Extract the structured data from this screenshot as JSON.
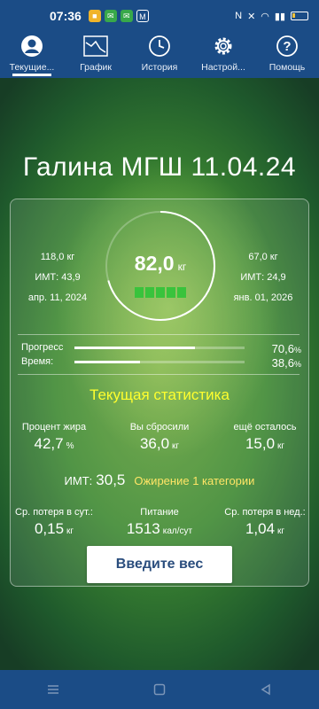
{
  "status_bar": {
    "time": "07:36"
  },
  "tabs": [
    {
      "label": "Текущие...",
      "icon": "person-icon",
      "active": true
    },
    {
      "label": "График",
      "icon": "chart-icon",
      "active": false
    },
    {
      "label": "История",
      "icon": "clock-icon",
      "active": false
    },
    {
      "label": "Настрой...",
      "icon": "gear-icon",
      "active": false
    },
    {
      "label": "Помощь",
      "icon": "help-icon",
      "active": false
    }
  ],
  "title": "Галина МГШ 11.04.24",
  "start": {
    "weight": "118,0 кг",
    "bmi": "ИМТ: 43,9",
    "date": "апр. 11, 2024"
  },
  "goal": {
    "weight": "67,0 кг",
    "bmi": "ИМТ: 24,9",
    "date": "янв. 01, 2026"
  },
  "current": {
    "weight": "82,0",
    "unit": "кг"
  },
  "ring_progress": 0.706,
  "progress": {
    "label": "Прогресс",
    "value": "70,6",
    "unit": "%",
    "fraction": 0.706
  },
  "time": {
    "label": "Время:",
    "value": "38,6",
    "unit": "%",
    "fraction": 0.386
  },
  "stats": {
    "title": "Текущая статистика",
    "fat": {
      "label": "Процент жира",
      "value": "42,7",
      "unit": "%"
    },
    "lost": {
      "label": "Вы сбросили",
      "value": "36,0",
      "unit": "кг"
    },
    "left": {
      "label": "ещё осталось",
      "value": "15,0",
      "unit": "кг"
    },
    "bmi_label": "ИМТ:",
    "bmi_value": "30,5",
    "bmi_category": "Ожирение 1 категории",
    "daily": {
      "label": "Ср. потеря в сут.:",
      "value": "0,15",
      "unit": "кг"
    },
    "food": {
      "label": "Питание",
      "value": "1513",
      "unit": "кал/сут"
    },
    "weekly": {
      "label": "Ср. потеря в нед.:",
      "value": "1,04",
      "unit": "кг"
    }
  },
  "button_label": "Введите вес",
  "colors": {
    "bar": "#1b4c86",
    "accent_yellow": "#ffff2e",
    "segment_green": "#39c33c"
  }
}
